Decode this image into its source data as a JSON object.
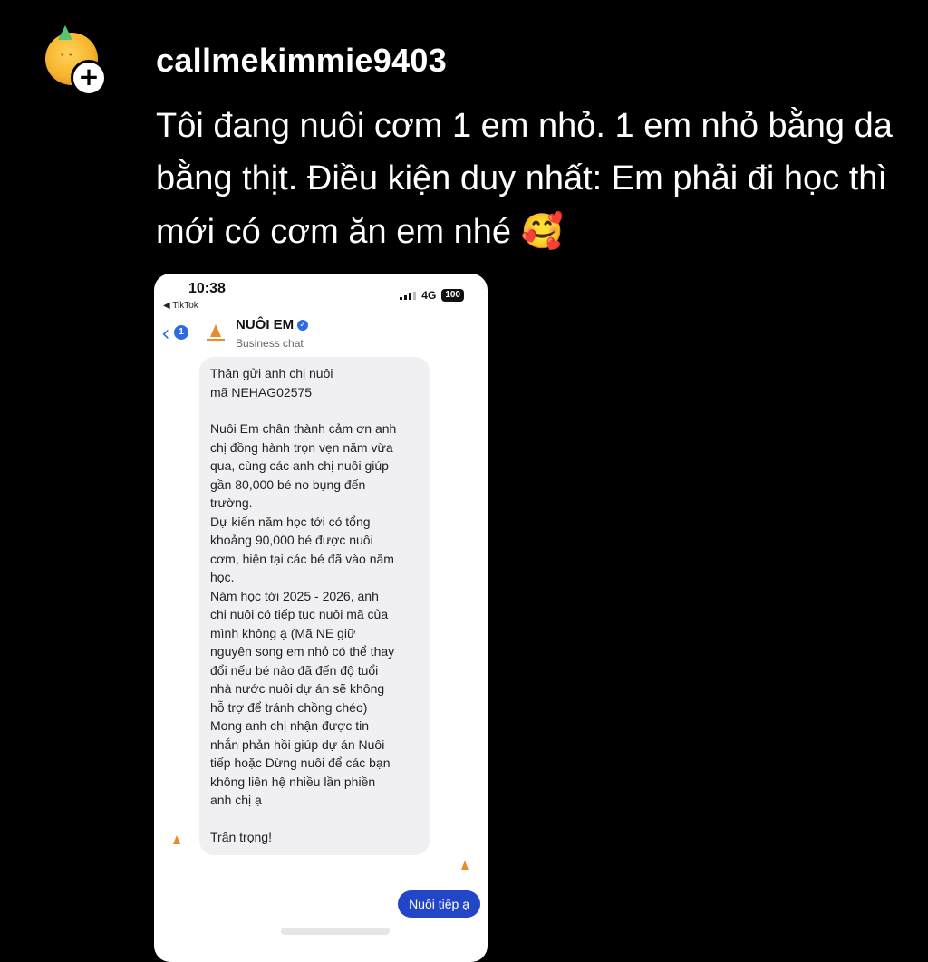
{
  "post": {
    "username": "callmekimmie9403",
    "caption": "Tôi đang nuôi cơm 1 em nhỏ. 1 em nhỏ bằng da bằng thịt. Điều kiện duy nhất: Em phải đi học thì mới có cơm ăn em nhé",
    "caption_emoji": "🥰",
    "follow_label": "+"
  },
  "phone": {
    "status": {
      "time": "10:38",
      "back_app": "◀ TikTok",
      "network": "4G",
      "battery": "100"
    },
    "chat": {
      "back_count": "1",
      "name": "NUÔI EM",
      "subtitle": "Business chat",
      "messages": [
        "Thân gửi anh chị nuôi\nmã NEHAG02575",
        "Nuôi Em chân thành cảm ơn anh\nchị đồng hành trọn vẹn năm vừa\nqua, cùng các anh chị nuôi giúp\ngần 80,000 bé no bụng đến\ntrường.\nDự kiến năm học tới có tổng\nkhoảng 90,000 bé được nuôi\ncơm, hiện tại các bé đã vào năm\nhọc.\nNăm học tới 2025 - 2026, anh\nchị nuôi có tiếp tục nuôi mã của\nmình không ạ (Mã NE giữ\nnguyên song em nhỏ có thể thay\nđổi nếu bé nào đã đến độ tuổi\nnhà nước nuôi dự án sẽ không\nhỗ trợ để tránh chồng chéo)\nMong anh chị nhận được tin\nnhắn phản hồi giúp dự án Nuôi\ntiếp hoặc Dừng nuôi để các bạn\nkhông liên hệ nhiều lần phiền\nanh chị ạ",
        "Trân trọng!"
      ],
      "reply": "Nuôi tiếp ạ"
    }
  }
}
